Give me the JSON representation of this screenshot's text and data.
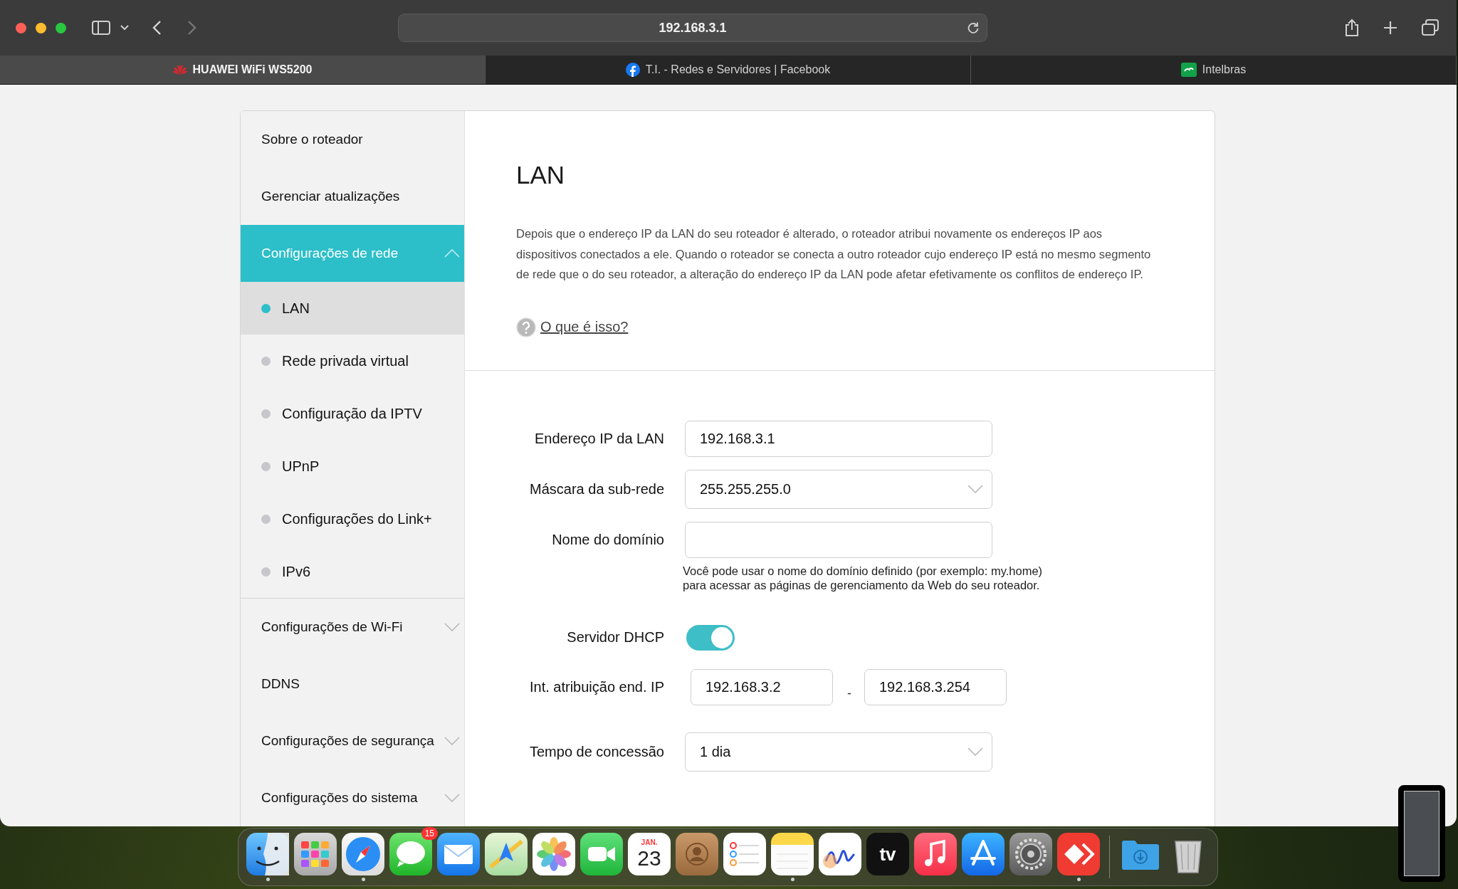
{
  "browser": {
    "address": "192.168.3.1",
    "back_disabled": false,
    "forward_disabled": true
  },
  "tabs": [
    {
      "title": "HUAWEI WiFi WS5200",
      "kind": "huawei",
      "selected": true
    },
    {
      "title": "T.I. - Redes e Servidores | Facebook",
      "kind": "facebook",
      "selected": false
    },
    {
      "title": "Intelbras",
      "kind": "intelbras",
      "selected": false
    }
  ],
  "sidebar": {
    "items": [
      {
        "label": "Sobre o roteador",
        "kind": "link",
        "selected": false
      },
      {
        "label": "Gerenciar atualizações",
        "kind": "link",
        "selected": false
      },
      {
        "label": "Configurações de rede",
        "kind": "group",
        "expanded": true,
        "selected": true,
        "children": [
          {
            "label": "LAN",
            "selected": true
          },
          {
            "label": "Rede privada virtual",
            "selected": false
          },
          {
            "label": "Configuração da IPTV",
            "selected": false
          },
          {
            "label": "UPnP",
            "selected": false
          },
          {
            "label": "Configurações do Link+",
            "selected": false
          },
          {
            "label": "IPv6",
            "selected": false
          }
        ]
      },
      {
        "label": "Configurações de Wi-Fi",
        "kind": "group",
        "expanded": false,
        "selected": false
      },
      {
        "label": "DDNS",
        "kind": "link",
        "selected": false
      },
      {
        "label": "Configurações de segurança",
        "kind": "group",
        "expanded": false,
        "selected": false
      },
      {
        "label": "Configurações do sistema",
        "kind": "group",
        "expanded": false,
        "selected": false
      }
    ]
  },
  "content": {
    "title": "LAN",
    "description": "Depois que o endereço IP da LAN do seu roteador é alterado, o roteador atribui novamente os endereços IP aos dispositivos conectados a ele. Quando o roteador se conecta a outro roteador cujo endereço IP está no mesmo segmento de rede que o do seu roteador, a alteração do endereço IP da LAN pode afetar efetivamente os conflitos de endereço IP.",
    "help_link": "O que é isso?",
    "form": [
      {
        "kind": "text",
        "label": "Endereço IP da LAN",
        "value": "192.168.3.1"
      },
      {
        "kind": "select",
        "label": "Máscara da sub-rede",
        "value": "255.255.255.0"
      },
      {
        "kind": "text",
        "label": "Nome do domínio",
        "hint": "Você pode usar o nome do domínio definido (por exemplo: my.home) para acessar as páginas de gerenciamento da Web do seu roteador."
      },
      {
        "kind": "toggle",
        "label": "Servidor DHCP",
        "on": true
      },
      {
        "kind": "range",
        "label": "Int. atribuição end. IP",
        "start": "192.168.3.2",
        "separator": "-",
        "end": "192.168.3.254"
      },
      {
        "kind": "select",
        "label": "Tempo de concessão",
        "value": "1 dia"
      }
    ]
  },
  "dock": [
    {
      "kind": "finder",
      "running": true
    },
    {
      "kind": "launchpad",
      "running": false
    },
    {
      "kind": "safari",
      "running": true
    },
    {
      "kind": "messages",
      "running": false,
      "badge": "15"
    },
    {
      "kind": "mail",
      "running": false
    },
    {
      "kind": "maps",
      "running": false
    },
    {
      "kind": "photos",
      "running": false
    },
    {
      "kind": "facetime",
      "running": false
    },
    {
      "kind": "calendar",
      "running": false,
      "month": "JAN.",
      "day": "23"
    },
    {
      "kind": "contacts",
      "running": false
    },
    {
      "kind": "reminders",
      "running": false
    },
    {
      "kind": "notes",
      "running": true
    },
    {
      "kind": "freeform",
      "running": false
    },
    {
      "kind": "tv",
      "running": false,
      "label": "tv"
    },
    {
      "kind": "music",
      "running": false
    },
    {
      "kind": "appstore",
      "running": false
    },
    {
      "kind": "settings",
      "running": false
    },
    {
      "kind": "remote",
      "running": true
    },
    {
      "kind": "separator"
    },
    {
      "kind": "downloads",
      "running": false
    },
    {
      "kind": "trash",
      "running": false
    }
  ]
}
